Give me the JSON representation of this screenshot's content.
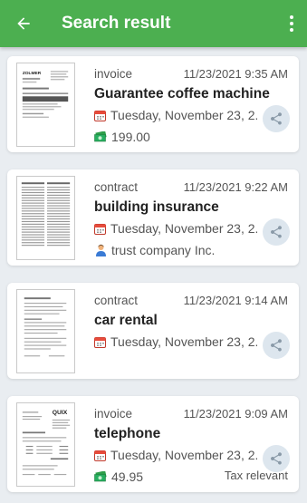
{
  "header": {
    "title": "Search result",
    "back_icon": "arrow-left-icon",
    "menu_icon": "more-vert-icon"
  },
  "colors": {
    "appbar": "#4caf50",
    "background": "#e9edf1",
    "share_bg": "#dde6ee"
  },
  "results": [
    {
      "type": "invoice",
      "datetime": "11/23/2021 9:35 AM",
      "title": "Guarantee coffee machine",
      "date_text": "Tuesday, November 23, 2...",
      "extra_icon": "money-icon",
      "extra_text": "199.00",
      "tax": ""
    },
    {
      "type": "contract",
      "datetime": "11/23/2021 9:22 AM",
      "title": "building insurance",
      "date_text": "Tuesday, November 23, 2...",
      "extra_icon": "person-icon",
      "extra_text": "trust company Inc.",
      "tax": ""
    },
    {
      "type": "contract",
      "datetime": "11/23/2021 9:14 AM",
      "title": "car rental",
      "date_text": "Tuesday, November 23, 2...",
      "extra_icon": "",
      "extra_text": "",
      "tax": ""
    },
    {
      "type": "invoice",
      "datetime": "11/23/2021 9:09 AM",
      "title": "telephone",
      "date_text": "Tuesday, November 23, 2...",
      "extra_icon": "money-icon",
      "extra_text": "49.95",
      "tax": "Tax relevant"
    }
  ],
  "thumb_logos": [
    "ZOLMER",
    "",
    "",
    "QUIX"
  ]
}
